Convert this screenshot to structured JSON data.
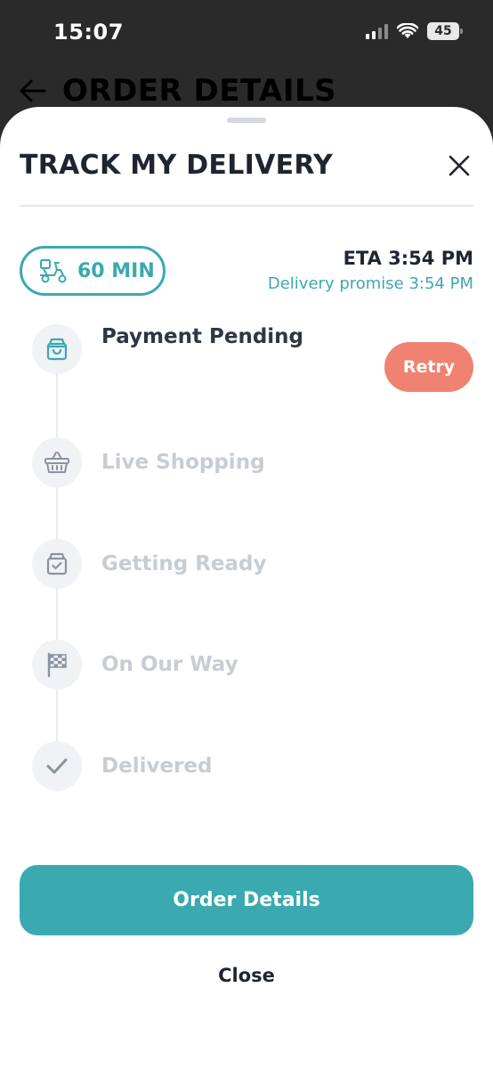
{
  "status_bar": {
    "time": "15:07",
    "battery": "45"
  },
  "background_page": {
    "title": "ORDER DETAILS"
  },
  "sheet": {
    "title": "TRACK MY DELIVERY",
    "eta_badge": "60 MIN",
    "eta_time": "ETA 3:54 PM",
    "delivery_promise": "Delivery promise 3:54 PM",
    "retry_label": "Retry",
    "steps": [
      {
        "label": "Payment Pending",
        "icon": "bag-icon",
        "active": true
      },
      {
        "label": "Live Shopping",
        "icon": "basket-icon",
        "active": false
      },
      {
        "label": "Getting Ready",
        "icon": "bag-check-icon",
        "active": false
      },
      {
        "label": "On Our Way",
        "icon": "checkered-flag-icon",
        "active": false
      },
      {
        "label": "Delivered",
        "icon": "checkmark-icon",
        "active": false
      }
    ],
    "primary_button": "Order Details",
    "close_label": "Close"
  },
  "colors": {
    "accent": "#3aa9b0",
    "retry": "#f08271",
    "text_dark": "#1f2530",
    "text_muted": "#c8ccd3"
  }
}
